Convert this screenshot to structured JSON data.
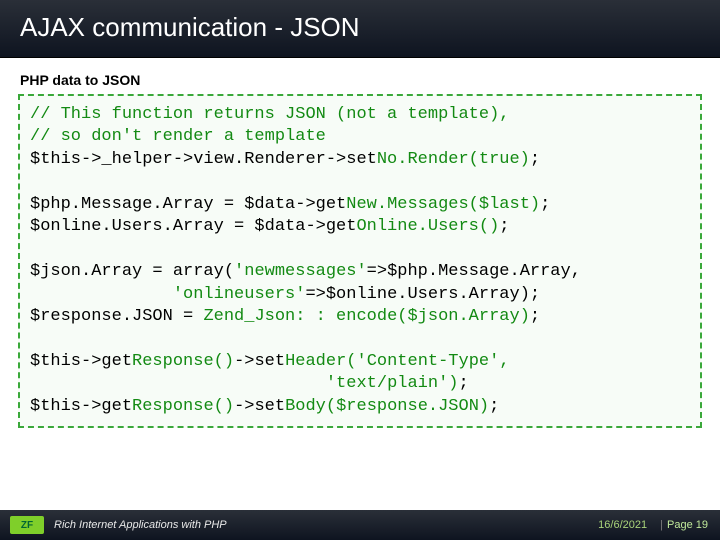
{
  "header": {
    "title": "AJAX communication - JSON"
  },
  "section": {
    "subtitle": "PHP data to JSON"
  },
  "code": {
    "l1": "// This function returns JSON (not a template),",
    "l2": "// so don't render a template",
    "l3a": "$this->_helper->view.Renderer->set",
    "l3b": "No.Render(true)",
    "l3c": ";",
    "l4": "",
    "l5a": "$php.Message.Array = $data->get",
    "l5b": "New.Messages($last)",
    "l5c": ";",
    "l6a": "$online.Users.Array = $data->get",
    "l6b": "Online.Users()",
    "l6c": ";",
    "l7": "",
    "l8a": "$json.Array = array(",
    "l8b": "'newmessages'",
    "l8c": "=>$php.Message.Array,",
    "l9a": "              ",
    "l9b": "'onlineusers'",
    "l9c": "=>$online.Users.Array);",
    "l10a": "$response.JSON = ",
    "l10b": "Zend_Json: : encode($json.Array)",
    "l10c": ";",
    "l11": "",
    "l12a": "$this->get",
    "l12b": "Response()",
    "l12c": "->set",
    "l12d": "Header('Content-Type',",
    "l13a": "                             ",
    "l13b": "'text/plain')",
    "l13c": ";",
    "l14a": "$this->get",
    "l14b": "Response()",
    "l14c": "->set",
    "l14d": "Body($response.JSON)",
    "l14e": ";"
  },
  "footer": {
    "course": "Rich Internet Applications with PHP",
    "date": "16/6/2021",
    "page_label": "Page 19"
  }
}
